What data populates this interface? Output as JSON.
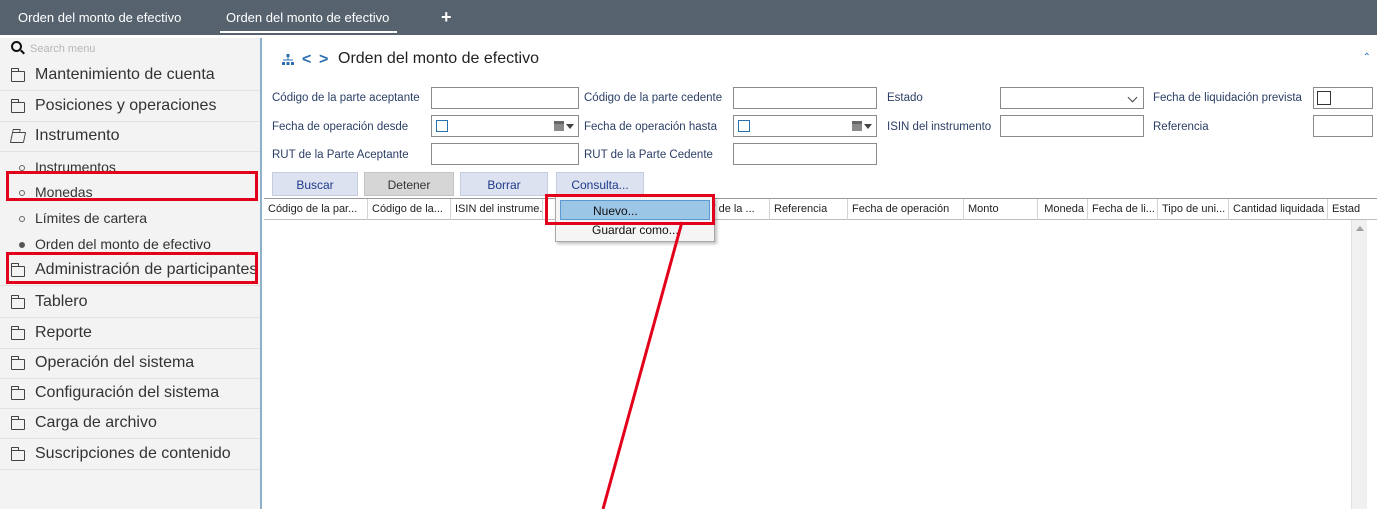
{
  "tabs": [
    {
      "label": "Orden del monto de efectivo"
    },
    {
      "label": "Orden del monto de efectivo"
    }
  ],
  "add_tab_label": "+",
  "sidebar": {
    "search_placeholder": "Search menu",
    "items": [
      {
        "label": "Mantenimiento de cuenta"
      },
      {
        "label": "Posiciones y operaciones"
      },
      {
        "label": "Instrumento"
      },
      {
        "label": "Administración de participantes"
      },
      {
        "label": "Tablero"
      },
      {
        "label": "Reporte"
      },
      {
        "label": "Operación del sistema"
      },
      {
        "label": "Configuración del sistema"
      },
      {
        "label": "Carga de archivo"
      },
      {
        "label": "Suscripciones de contenido"
      }
    ],
    "subitems": [
      {
        "label": "Instrumentos"
      },
      {
        "label": "Monedas"
      },
      {
        "label": "Límites de cartera"
      },
      {
        "label": "Orden del monto de efectivo"
      }
    ]
  },
  "breadcrumb": {
    "back": "<",
    "forward": ">",
    "title": "Orden del monto de efectivo"
  },
  "form": {
    "codigo_aceptante": "Código de la parte aceptante",
    "codigo_cedente": "Código de la parte cedente",
    "estado": "Estado",
    "fecha_liquidacion": "Fecha de liquidación prevista",
    "fecha_desde": "Fecha de operación desde",
    "fecha_hasta": "Fecha de operación hasta",
    "isin": "ISIN del instrumento",
    "referencia": "Referencia",
    "rut_aceptante": "RUT de la Parte Aceptante",
    "rut_cedente": "RUT de la Parte Cedente"
  },
  "buttons": {
    "buscar": "Buscar",
    "detener": "Detener",
    "borrar": "Borrar",
    "consulta": "Consulta..."
  },
  "columns": [
    "Código de la par...",
    "Código de la...",
    "ISIN del instrume...",
    "",
    "T de la ...",
    "Referencia",
    "Fecha de operación",
    "Monto",
    "Moneda",
    "Fecha de li...",
    "Tipo de uni...",
    "Cantidad liquidada",
    "Estad"
  ],
  "context_menu": {
    "nuevo": "Nuevo...",
    "guardar": "Guardar como..."
  },
  "colors": {
    "topbar": "#56636e",
    "annotation": "#e3001b",
    "link_blue": "#2a6fb0",
    "button_bg": "#dde2f1"
  }
}
